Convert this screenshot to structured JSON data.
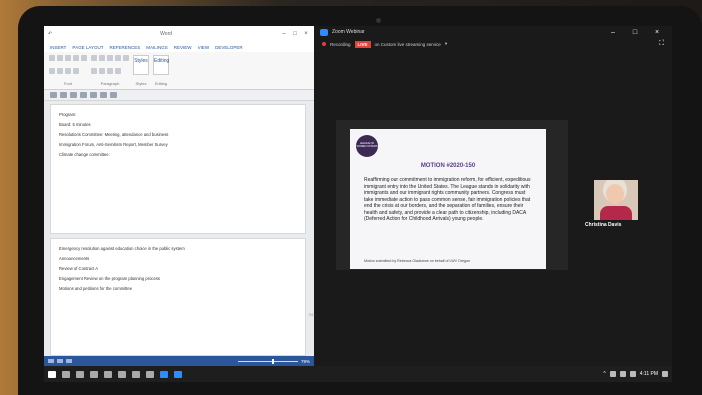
{
  "word": {
    "title_bar": "Word",
    "tabs": [
      "INSERT",
      "PAGE LAYOUT",
      "REFERENCES",
      "MAILINGS",
      "REVIEW",
      "VIEW",
      "DEVELOPER"
    ],
    "ribbon_groups": [
      "Font",
      "Paragraph",
      "Styles",
      "Editing"
    ],
    "styles_label": "Styles",
    "editing_label": "Editing",
    "page1_lines": [
      "Program:",
      "Board: 5 minutes",
      "Resolutions Committee: Meeting, attendance and business",
      "Immigration Forum, Anti-Semitism Report, Member Survey",
      "Climate change committee:"
    ],
    "page2_lines": [
      "Emergency resolution against education choice in the public system",
      "Announcements",
      "Review of Contract A",
      "Engagement Review on the program planning process",
      "Motions and petitions for the committee"
    ],
    "zoom_percent": "79%"
  },
  "zoom": {
    "app_name": "Zoom Webinar",
    "recording_label": "Recording",
    "live_label": "LIVE",
    "stream_label": "on Custom live streaming service",
    "slide": {
      "logo_text": "LEAGUE OF WOMEN VOTERS",
      "title": "MOTION #2020-150",
      "body": "Reaffirming our commitment to immigration reform, for efficient, expeditious immigrant entry into the United States. The League stands in solidarity with immigrants and our immigrant rights community partners. Congress must take immediate action to pass common sense, fair immigration policies that end the crisis at our borders, and the separation of families, ensure their health and safety, and provide a clear path to citizenship, including DACA (Deferred Action for Childhood Arrivals) young people.",
      "footer": "Motion submitted by Rebecca Gladstone on behalf of LWV Oregon"
    },
    "participant_name": "Christina Davis"
  },
  "taskbar": {
    "clock": "4:11 PM"
  }
}
